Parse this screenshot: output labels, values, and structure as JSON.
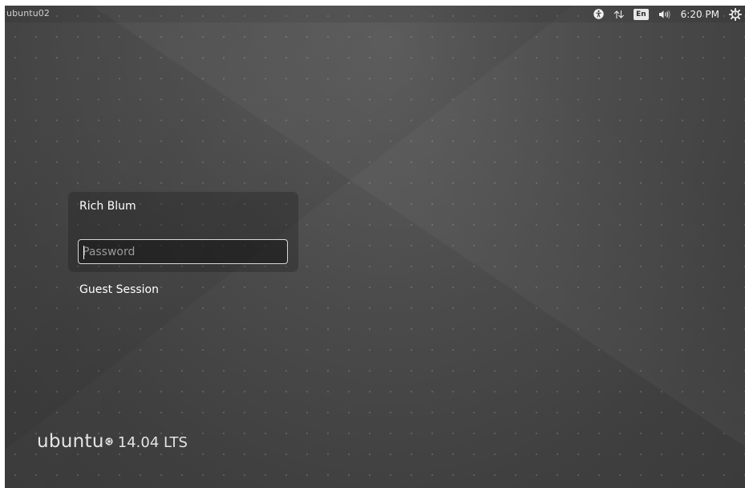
{
  "top_panel": {
    "hostname": "ubuntu02",
    "indicators": [
      {
        "icon": "accessibility-icon"
      },
      {
        "icon": "network-icon"
      },
      {
        "icon": "keyboard-layout-icon",
        "label": "En"
      },
      {
        "icon": "volume-icon"
      }
    ],
    "keyboard_layout": "En",
    "clock": "6:20 PM",
    "session_icon": "gear-power-icon"
  },
  "login": {
    "user_name": "Rich Blum",
    "password_placeholder": "Password",
    "guest_session": "Guest Session"
  },
  "branding": {
    "wordmark": "ubuntu",
    "logo_icon": "circle-of-friends-icon",
    "version": "14.04 LTS"
  },
  "colors": {
    "background": "#4b4b4b",
    "text": "#ffffff",
    "field_border": "#d8d8d8"
  }
}
